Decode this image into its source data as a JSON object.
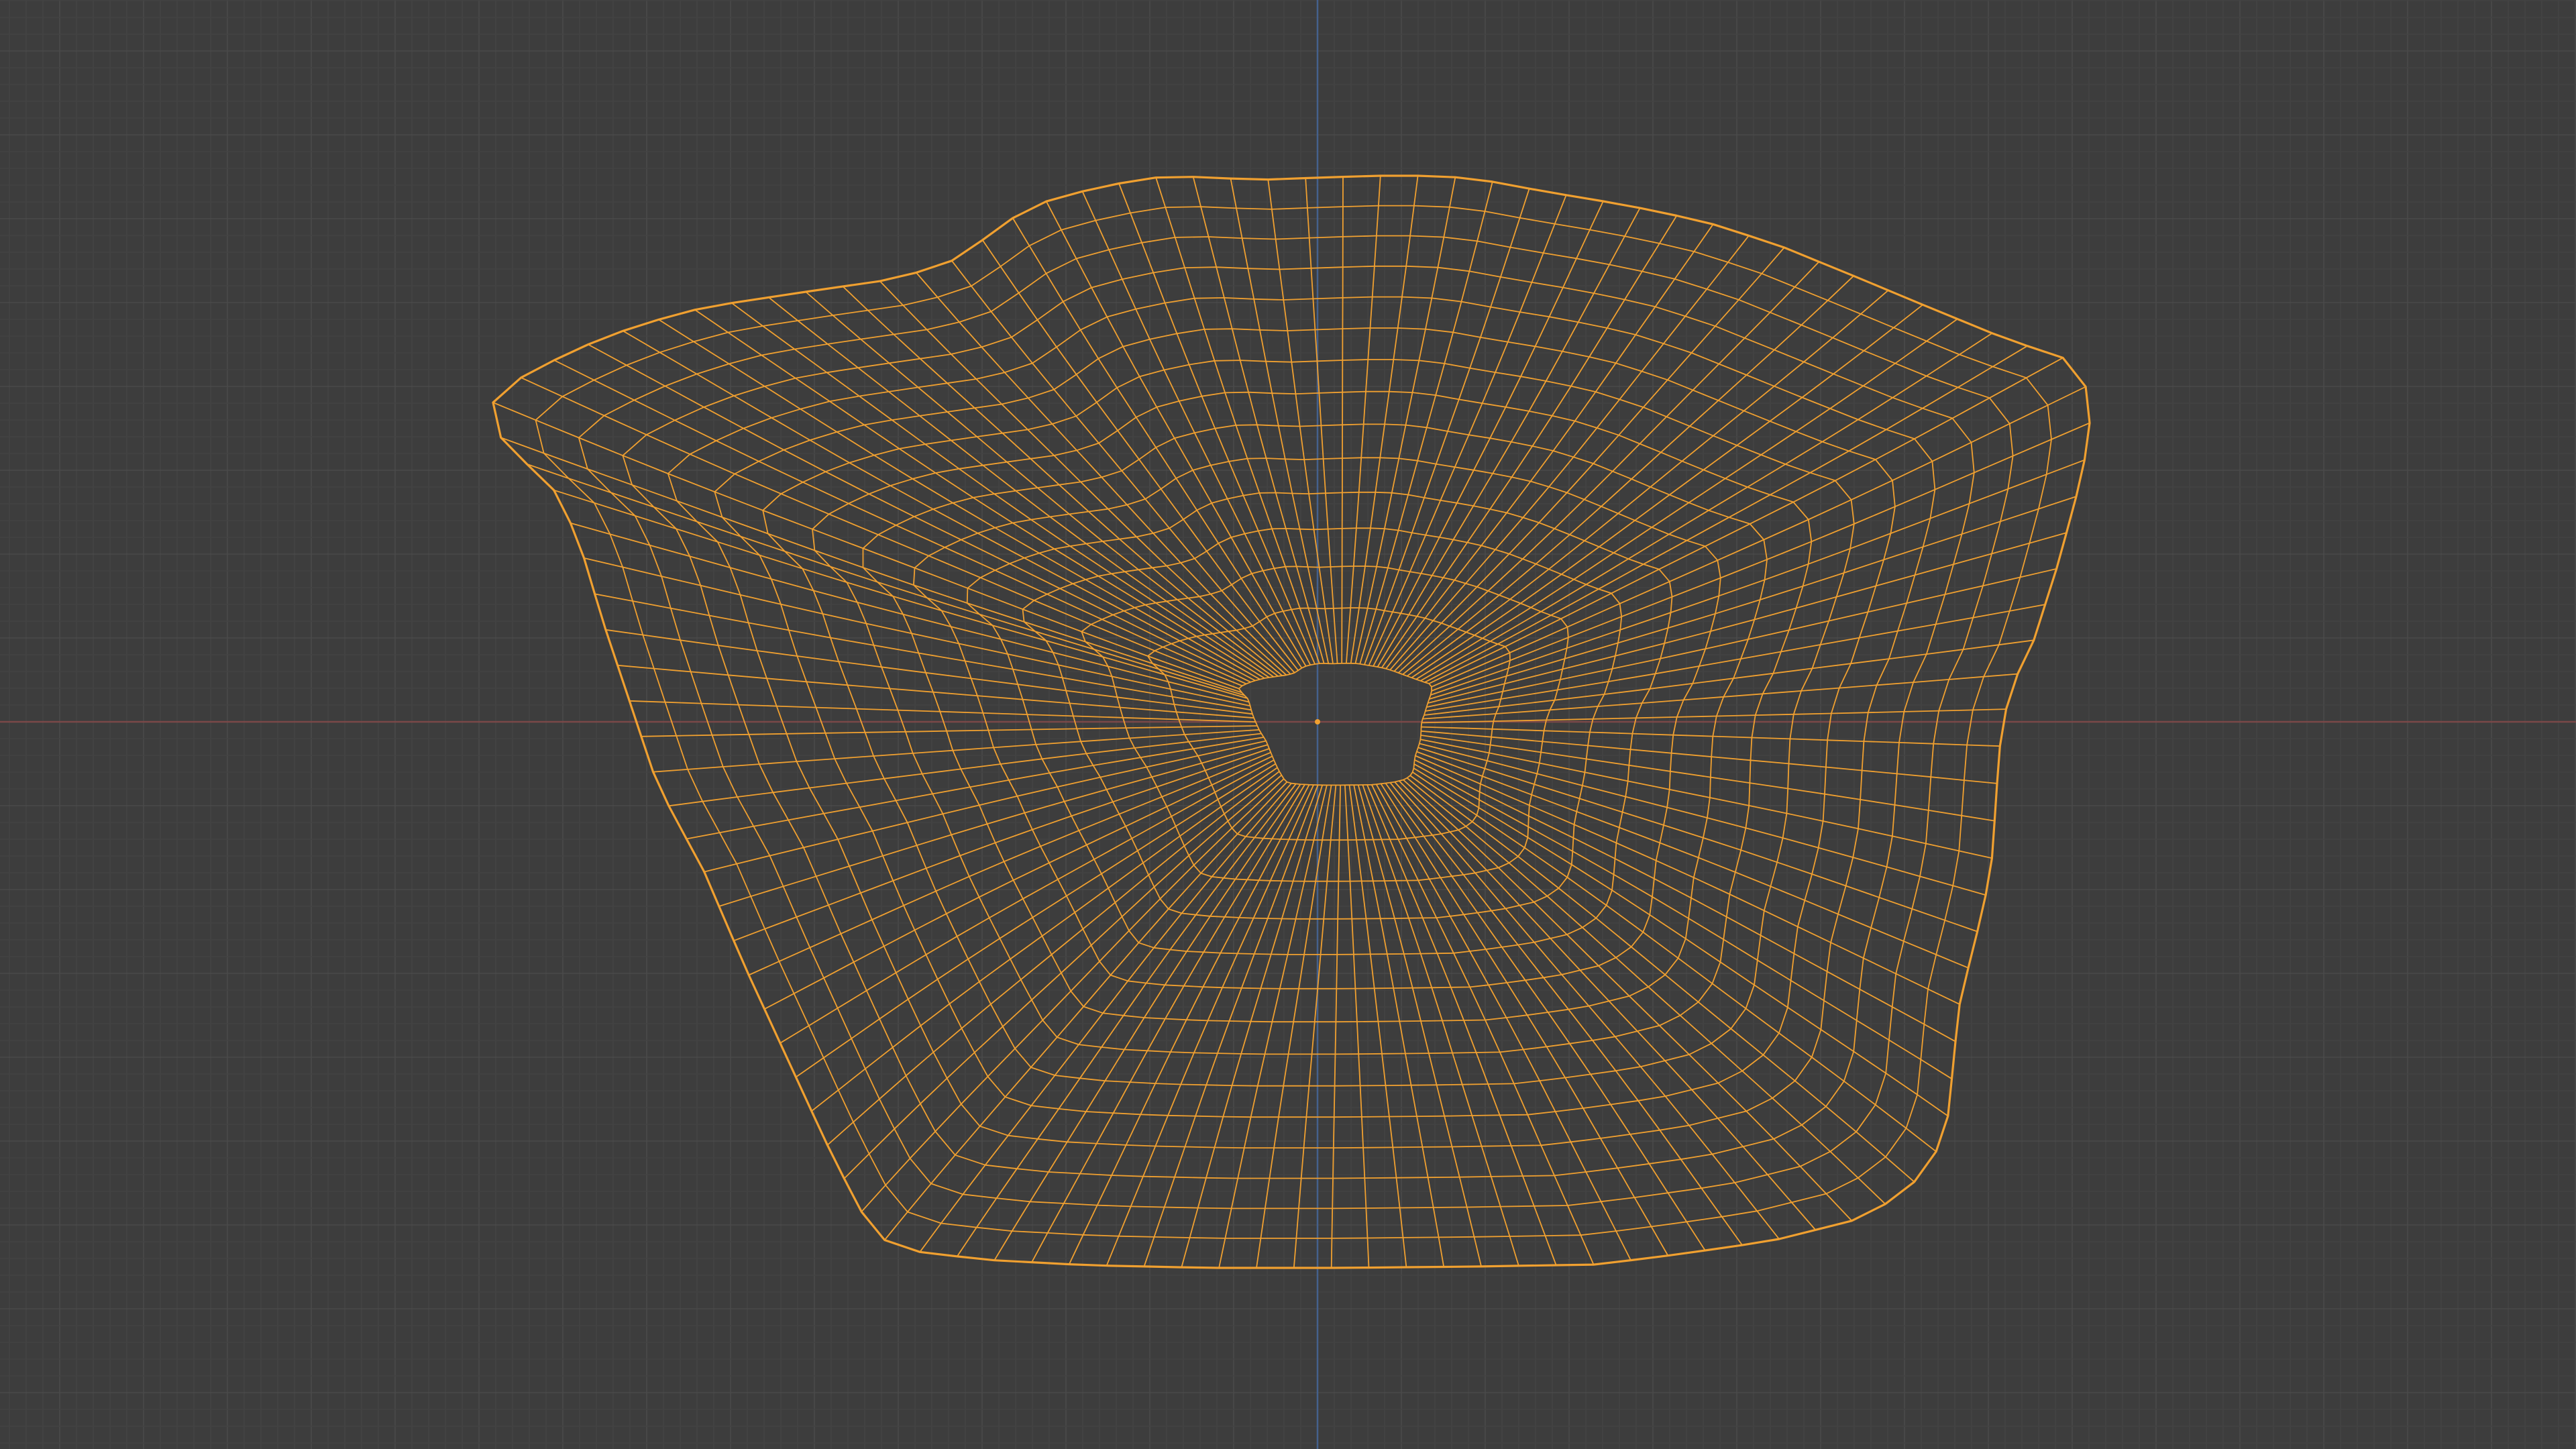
{
  "viewport": {
    "view_mode": "wireframe",
    "background_color": "#3d3d3d",
    "grid": {
      "visible": true,
      "minor_color": "#434343",
      "major_color": "#4a4a4a"
    },
    "axes": {
      "x_axis_color": "#7a4848",
      "y_axis_color": "#45608c"
    },
    "object": {
      "type": "mesh",
      "selected": true,
      "wire_color": "#f0a030",
      "origin_color": "#f0a030"
    }
  }
}
